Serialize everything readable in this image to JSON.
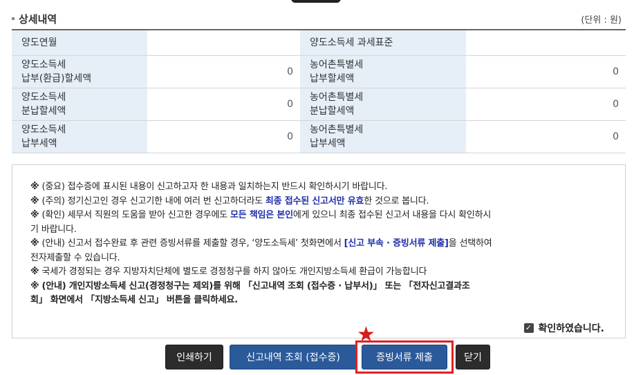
{
  "section": {
    "title": "상세내역",
    "unit": "(단위 : 원)"
  },
  "detail_rows": [
    {
      "label1": "양도연월",
      "value1": "",
      "label2": "양도소득세 과세표준",
      "value2": ""
    },
    {
      "label1": "양도소득세\n납부(환급)할세액",
      "value1": "0",
      "label2": "농어촌특별세\n납부할세액",
      "value2": "0"
    },
    {
      "label1": "양도소득세\n분납할세액",
      "value1": "0",
      "label2": "농어촌특별세\n분납할세액",
      "value2": "0"
    },
    {
      "label1": "양도소득세\n납부세액",
      "value1": "0",
      "label2": "농어촌특별세\n납부세액",
      "value2": "0"
    }
  ],
  "notice": {
    "mark": "※",
    "l1": "(중요) 접수증에 표시된 내용이 신고하고자 한 내용과 일치하는지 반드시 확인하시기 바랍니다.",
    "l2a": "(주의) 정기신고인 경우 신고기한 내에 여러 번 신고하더라도 ",
    "l2b": "최종 접수된 신고서만 유효",
    "l2c": "한 것으로 봅니다.",
    "l3a": "(확인) 세무서 직원의 도움을 받아 신고한 경우에도 ",
    "l3b": "모든 책임은 본인",
    "l3c": "에게 있으니 최종 접수된 신고서 내용을 다시 확인하시",
    "l3d": "기 바랍니다.",
    "l4a": "(안내) 신고서 접수완료 후 관련 증빙서류를 제출할 경우, ‘양도소득세’ 첫화면에서 ",
    "l4b": "[신고 부속 · 증빙서류 제출]",
    "l4c": "을 선택하여",
    "l4d": "전자제출할 수 있습니다.",
    "l5": "국세가 경정되는 경우 지방자치단체에 별도로 경정청구를 하지 않아도 개인지방소득세 환급이 가능합니다",
    "l6a": "(안내) 개인지방소득세 신고(경정청구는 제외)를 위해 「신고내역 조회 (접수증 · 납부서)」 또는 「전자신고결과조",
    "l6b": "회」 화면에서 「지방소득세 신고」 버튼을 클릭하세요.",
    "confirm_check": "✓",
    "confirm": "확인하였습니다."
  },
  "buttons": {
    "print": "인쇄하기",
    "history": "신고내역 조회 (접수증)",
    "submit_docs": "증빙서류 제출",
    "close": "닫기"
  },
  "annotation": {
    "star": "★",
    "color": "#e02020"
  }
}
